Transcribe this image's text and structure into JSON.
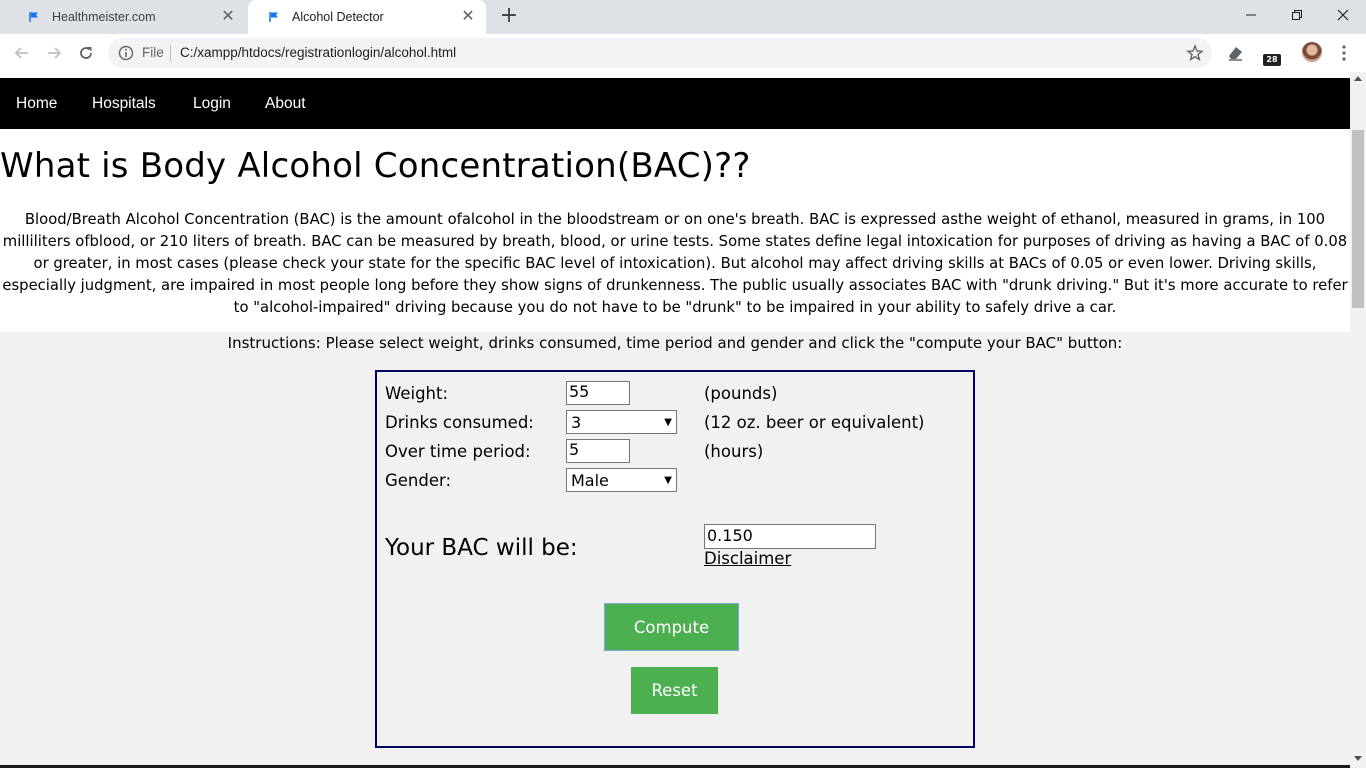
{
  "browser": {
    "tabs": [
      {
        "title": "Healthmeister.com",
        "active": false
      },
      {
        "title": "Alcohol Detector",
        "active": true
      }
    ],
    "address": {
      "scheme_label": "File",
      "url": "C:/xampp/htdocs/registrationlogin/alcohol.html"
    },
    "extension_badge": "28",
    "colors": {
      "tabbar": "#dee1e6",
      "toolbar": "#ffffff",
      "omnibox": "#f1f3f4"
    }
  },
  "nav": {
    "items": [
      "Home",
      "Hospitals",
      "Login",
      "About"
    ],
    "background": "#000000"
  },
  "content": {
    "heading": "What is Body Alcohol Concentration(BAC)??",
    "paragraph": "Blood/Breath Alcohol Concentration (BAC) is the amount ofalcohol in the bloodstream or on one's breath. BAC is expressed asthe weight of ethanol, measured in grams, in 100 milliliters ofblood, or 210 liters of breath. BAC can be measured by breath, blood, or urine tests. Some states define legal intoxication for purposes of driving as having a BAC of 0.08 or greater, in most cases (please check your state for the specific BAC level of intoxication). But alcohol may affect driving skills at BACs of 0.05 or even lower. Driving skills, especially judgment, are impaired in most people long before they show signs of drunkenness. The public usually associates BAC with \"drunk driving.\" But it's more accurate to refer to \"alcohol-impaired\" driving because you do not have to be \"drunk\" to be impaired in your ability to safely drive a car.",
    "instructions": "Instructions: Please select weight, drinks consumed, time period and gender and click the \"compute your BAC\" button:"
  },
  "calculator": {
    "weight": {
      "label": "Weight:",
      "value": "55",
      "unit": "(pounds)"
    },
    "drinks": {
      "label": "Drinks consumed:",
      "value": "3",
      "unit": "(12 oz. beer or equivalent)"
    },
    "time": {
      "label": "Over time period:",
      "value": "5",
      "unit": "(hours)"
    },
    "gender": {
      "label": "Gender:",
      "value": "Male"
    },
    "result": {
      "label": "Your BAC will be:",
      "value": "0.150",
      "disclaimer": "Disclaimer"
    },
    "compute_label": "Compute",
    "reset_label": "Reset",
    "colors": {
      "button": "#4caf50",
      "border": "#000066"
    }
  }
}
